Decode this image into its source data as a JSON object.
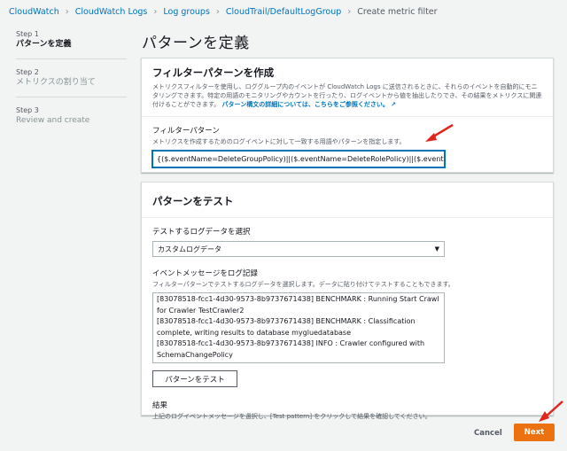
{
  "breadcrumb": [
    "CloudWatch",
    "CloudWatch Logs",
    "Log groups",
    "CloudTrail/DefaultLogGroup",
    "Create metric filter"
  ],
  "steps": [
    {
      "num": "Step 1",
      "label": "パターンを定義"
    },
    {
      "num": "Step 2",
      "label": "メトリクスの割り当て"
    },
    {
      "num": "Step 3",
      "label": "Review and create"
    }
  ],
  "page_title": "パターンを定義",
  "pattern_panel": {
    "title": "フィルターパターンを作成",
    "desc": "メトリクスフィルターを使用し、ロググループ内のイベントが CloudWatch Logs に送信されるときに、それらのイベントを自動的にモニタリングできます。特定の用語のモニタリングやカウントを行ったり、ログイベントから値を抽出したりでき、その結果をメトリクスに関連付けることができます。",
    "link": "パターン構文の詳細については、こちらをご参照ください。",
    "field_label": "フィルターパターン",
    "field_desc": "メトリクスを作成するためのログイベントに対して一致する用語やパターンを指定します。",
    "field_value": "{($.eventName=DeleteGroupPolicy)||($.eventName=DeleteRolePolicy)||($.eventNa"
  },
  "test_panel": {
    "title": "パターンをテスト",
    "select_label": "テストするログデータを選択",
    "select_value": "カスタムログデータ",
    "log_label": "イベントメッセージをログ記録",
    "log_desc": "フィルターパターンでテストするログデータを選択します。データに貼り付けてテストすることもできます。",
    "log_lines": [
      "[83078518-fcc1-4d30-9573-8b9737671438] BENCHMARK : Running Start Crawl",
      "for Crawler TestCrawler2",
      "[83078518-fcc1-4d30-9573-8b9737671438] BENCHMARK : Classification",
      "complete, writing results to database mygluedatabase",
      "[83078518-fcc1-4d30-9573-8b9737671438] INFO : Crawler configured with",
      "SchemaChangePolicy"
    ],
    "test_button": "パターンをテスト",
    "result_label": "結果",
    "result_desc": "上記のログイベントメッセージを選択し、[Test pattern] をクリックして結果を確認してください。"
  },
  "footer": {
    "cancel": "Cancel",
    "next": "Next"
  },
  "colors": {
    "accent": "#ec7211",
    "link": "#0073bb",
    "arrow": "#e3241b"
  }
}
